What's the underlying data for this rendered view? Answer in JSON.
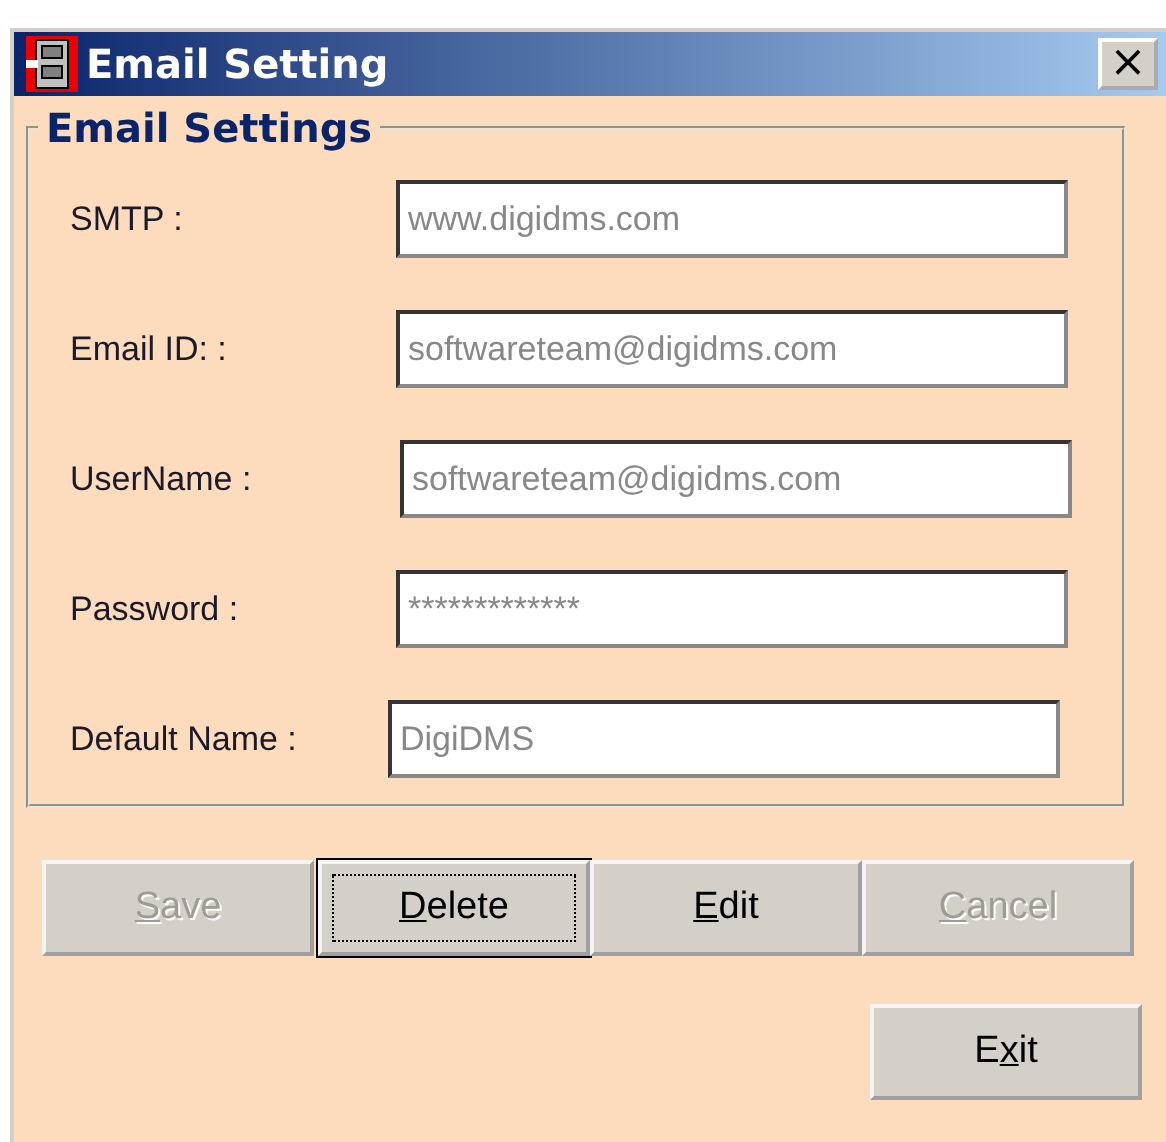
{
  "window": {
    "title": "Email Setting",
    "close": "×"
  },
  "group": {
    "title": "Email Settings",
    "fields": [
      {
        "label": "SMTP :",
        "value": "www.digidms.com"
      },
      {
        "label": "Email ID: :",
        "value": "softwareteam@digidms.com"
      },
      {
        "label": "UserName :",
        "value": "softwareteam@digidms.com"
      },
      {
        "label": "Password :",
        "value": "*************"
      },
      {
        "label": "Default Name :",
        "value": "DigiDMS"
      }
    ]
  },
  "buttons": [
    {
      "access_key": "S",
      "label_rest": "ave",
      "disabled": true,
      "focused": false
    },
    {
      "access_key": "D",
      "label_rest": "elete",
      "disabled": false,
      "focused": true
    },
    {
      "access_key": "E",
      "label_rest": "dit",
      "disabled": false,
      "focused": false
    },
    {
      "access_key": "C",
      "label_rest": "ancel",
      "disabled": true,
      "focused": false
    }
  ],
  "exit_button": {
    "label_start": "E",
    "access_key": "x",
    "label_rest": "it",
    "disabled": false,
    "focused": false
  }
}
